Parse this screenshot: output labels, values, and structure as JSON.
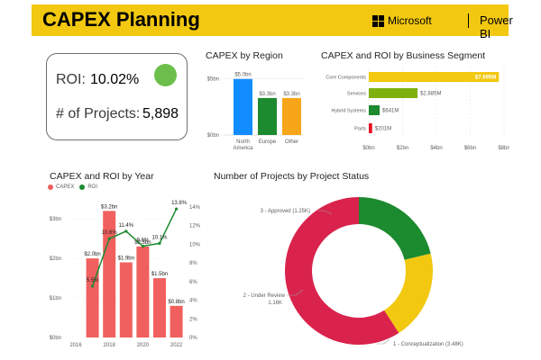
{
  "header": {
    "title": "CAPEX Planning",
    "microsoft_label": "Microsoft",
    "powerbi_label": "Power BI",
    "banner_color": "#f2c811"
  },
  "kpi": {
    "roi_label": "ROI:",
    "roi_value": "10.02%",
    "projects_label": "# of Projects:",
    "projects_value": "5,898",
    "status_color": "#6cbf4a"
  },
  "region": {
    "title": "CAPEX by Region",
    "y_ticks": [
      "$5bn",
      "$0bn"
    ],
    "bars": [
      {
        "label": "North America",
        "label_lines": [
          "North",
          "America"
        ],
        "value": 5.0,
        "value_label": "$5.0bn",
        "color": "#118dff"
      },
      {
        "label": "Europe",
        "label_lines": [
          "Europe"
        ],
        "value": 3.3,
        "value_label": "$3.3bn",
        "color": "#1c8a2e"
      },
      {
        "label": "Other",
        "label_lines": [
          "Other"
        ],
        "value": 3.3,
        "value_label": "$3.3bn",
        "color": "#f7a519"
      }
    ]
  },
  "segment": {
    "title": "CAPEX and ROI by Business Segment",
    "x_ticks": [
      "$0bn",
      "$2bn",
      "$4bn",
      "$6bn",
      "$8bn"
    ],
    "bars": [
      {
        "label": "Core Components",
        "value": 7.695,
        "value_label": "$7.695M",
        "color": "#f2c811"
      },
      {
        "label": "Services",
        "value": 2.885,
        "value_label": "$2.885M",
        "color": "#7fb10e"
      },
      {
        "label": "Hybrid Systems",
        "value": 0.641,
        "value_label": "$641M",
        "color": "#1c8a2e"
      },
      {
        "label": "Parts",
        "value": 0.201,
        "value_label": "$201M",
        "color": "#e81123"
      }
    ]
  },
  "year": {
    "title": "CAPEX and ROI by Year",
    "legend": [
      {
        "name": "CAPEX",
        "color": "#f0605e"
      },
      {
        "name": "ROI",
        "color": "#1c8a2e"
      }
    ],
    "x_ticks": [
      "2016",
      "2018",
      "2020",
      "2022"
    ],
    "y_left_ticks": [
      "$3bn",
      "$2bn",
      "$1bn",
      "$0bn"
    ],
    "y_right_ticks": [
      "14%",
      "12%",
      "10%",
      "8%",
      "6%",
      "4%",
      "2%",
      "0%"
    ]
  },
  "status": {
    "title": "Number of Projects by Project Status",
    "slices": [
      {
        "label": "3 - Approved (1.25K)",
        "value": 1250,
        "color": "#1c8a2e"
      },
      {
        "label": "2 - Under Review",
        "sublabel": "1.16K",
        "value": 1160,
        "color": "#f2c811"
      },
      {
        "label": "1 - Conceptualization (3.48K)",
        "value": 3480,
        "color": "#d9234c"
      }
    ]
  },
  "chart_data": [
    {
      "type": "bar",
      "title": "CAPEX by Region",
      "categories": [
        "North America",
        "Europe",
        "Other"
      ],
      "values": [
        5.0,
        3.3,
        3.3
      ],
      "ylabel": "",
      "ylim": [
        0,
        5.3
      ]
    },
    {
      "type": "bar",
      "title": "CAPEX and ROI by Business Segment",
      "orientation": "horizontal",
      "categories": [
        "Core Components",
        "Services",
        "Hybrid Systems",
        "Parts"
      ],
      "values": [
        7.695,
        2.885,
        0.641,
        0.201
      ],
      "xlim": [
        0,
        8
      ]
    },
    {
      "type": "bar",
      "title": "CAPEX and ROI by Year",
      "x": [
        2017,
        2018,
        2019,
        2020,
        2021,
        2022
      ],
      "series": [
        {
          "name": "CAPEX",
          "type": "bar",
          "values": [
            2.0,
            3.2,
            1.9,
            2.3,
            1.5,
            0.8
          ],
          "labels": [
            "$2.0bn",
            "$3.2bn",
            "$1.9bn",
            "$2.3bn",
            "$1.5bn",
            "$0.8bn"
          ],
          "color": "#f0605e"
        },
        {
          "name": "ROI",
          "type": "line",
          "values": [
            5.5,
            10.6,
            11.4,
            9.8,
            10.1,
            13.8
          ],
          "labels": [
            "5.5%",
            "10.6%",
            "11.4%",
            "9.8%",
            "10.1%",
            "13.8%"
          ],
          "color": "#1c8a2e"
        }
      ],
      "xlim": [
        2016,
        2022.5
      ],
      "ylim_left": [
        0,
        3.3
      ],
      "ylim_right": [
        0,
        14
      ]
    },
    {
      "type": "pie",
      "title": "Number of Projects by Project Status",
      "categories": [
        "1 - Conceptualization",
        "2 - Under Review",
        "3 - Approved"
      ],
      "values": [
        3480,
        1160,
        1250
      ]
    }
  ]
}
